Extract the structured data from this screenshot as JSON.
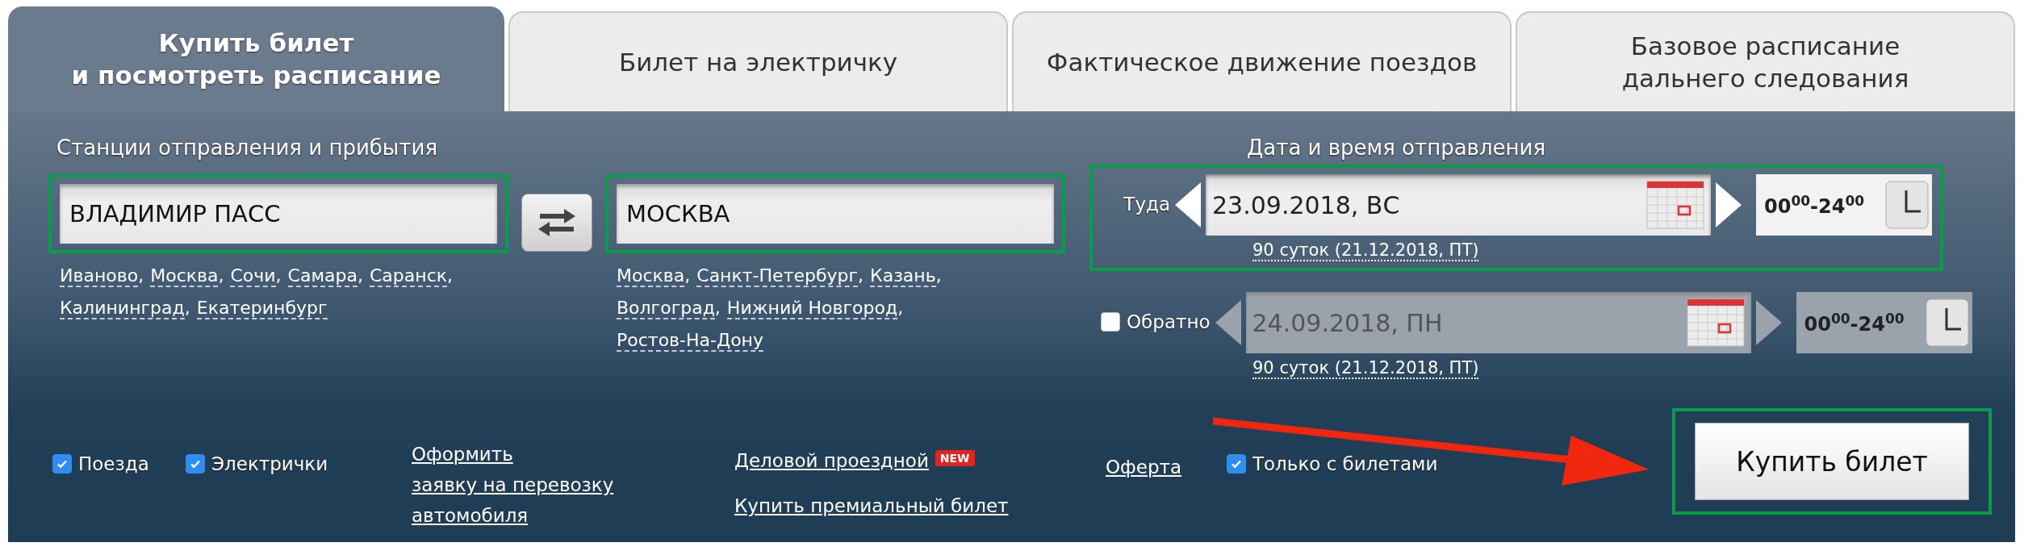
{
  "tabs": [
    {
      "label": "Купить билет\nи посмотреть расписание",
      "selected": true
    },
    {
      "label": "Билет на электричку",
      "selected": false
    },
    {
      "label": "Фактическое движение поездов",
      "selected": false
    },
    {
      "label": "Базовое расписание\nдальнего следования",
      "selected": false
    }
  ],
  "stations": {
    "heading": "Станции отправления и прибытия",
    "separator": ",",
    "from": {
      "value": "ВЛАДИМИР ПАСС",
      "highlighted": true,
      "suggestions": [
        "Иваново",
        "Москва",
        "Сочи",
        "Самара",
        "Саранск",
        "Калининград",
        "Екатеринбург"
      ]
    },
    "to": {
      "value": "МОСКВА",
      "highlighted": true,
      "suggestions": [
        "Москва",
        "Санкт-Петербург",
        "Казань",
        "Волгоград",
        "Нижний Новгород",
        "Ростов-На-Дону"
      ]
    }
  },
  "dates": {
    "heading": "Дата и время отправления",
    "rows": [
      {
        "kind": "label",
        "label": "Туда",
        "highlighted": true,
        "disabled": false,
        "date": "23.09.2018, ВС",
        "limit": "90 суток (21.12.2018, ПТ)",
        "time": "00$^{00}$-24$^{00}$"
      },
      {
        "kind": "checkbox",
        "label": "Обратно",
        "checked": false,
        "disabled": true,
        "date": "24.09.2018, ПН",
        "limit": "90 суток (21.12.2018, ПТ)",
        "time": "00$^{00}$-24$^{00}$"
      }
    ]
  },
  "filters": [
    {
      "label": "Поезда",
      "checked": true
    },
    {
      "label": "Электрички",
      "checked": true
    }
  ],
  "car_link": "Оформить\nзаявку на перевозку\nавтомобиля",
  "business_link": {
    "label": "Деловой проездной",
    "badge": "NEW"
  },
  "premium_link": "Купить премиальный билет",
  "offer_link": "Оферта",
  "only_with_tickets": {
    "label": "Только с билетами",
    "checked": true
  },
  "buy_button": {
    "label": "Купить билет",
    "highlighted": true
  }
}
